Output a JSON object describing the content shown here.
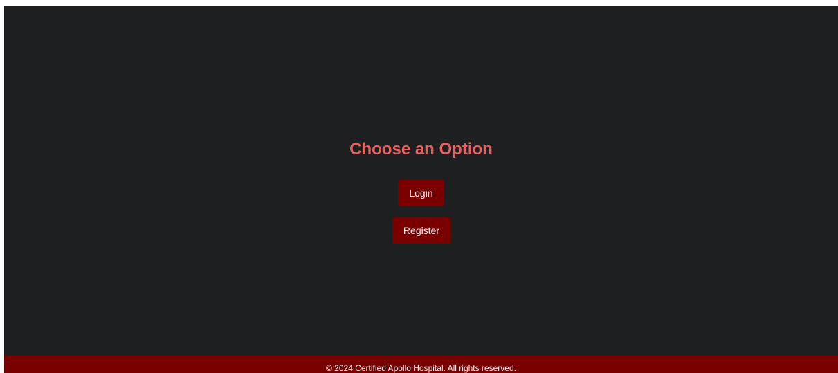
{
  "main": {
    "title": "Choose an Option",
    "login_label": "Login",
    "register_label": "Register"
  },
  "footer": {
    "text": "© 2024 Certified Apollo Hospital. All rights reserved."
  },
  "colors": {
    "background": "#1d1f20",
    "title": "#e8625f",
    "button": "#7a0000",
    "footer": "#780000",
    "button_text": "#f2f2f2"
  }
}
